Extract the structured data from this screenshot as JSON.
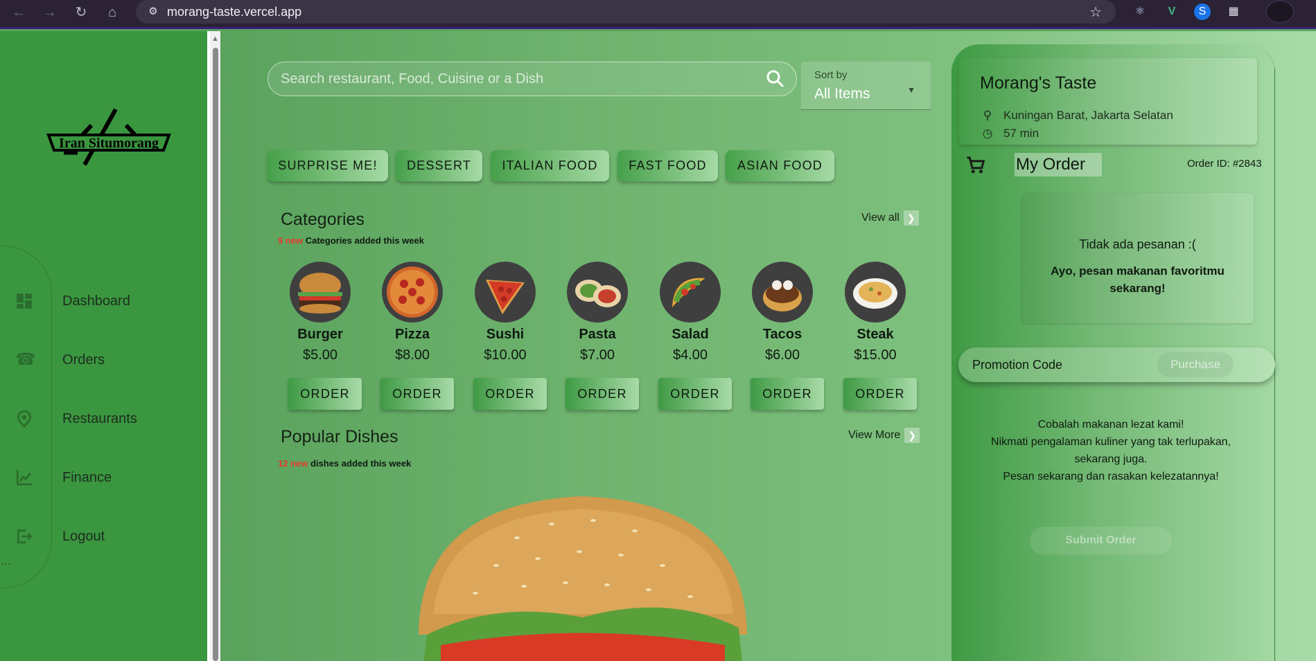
{
  "browser": {
    "url": "morang-taste.vercel.app"
  },
  "sidebar": {
    "logo_text": "Iran Situmorang",
    "items": [
      {
        "label": "Dashboard",
        "icon": "dashboard-icon"
      },
      {
        "label": "Orders",
        "icon": "phone-icon"
      },
      {
        "label": "Restaurants",
        "icon": "location-pin-icon"
      },
      {
        "label": "Finance",
        "icon": "chart-icon"
      },
      {
        "label": "Logout",
        "icon": "logout-icon"
      }
    ],
    "dots": "..."
  },
  "search": {
    "placeholder": "Search restaurant, Food, Cuisine or a Dish"
  },
  "sort": {
    "label": "Sort by",
    "value": "All Items"
  },
  "chips": [
    "SURPRISE ME!",
    "DESSERT",
    "ITALIAN FOOD",
    "FAST FOOD",
    "ASIAN FOOD"
  ],
  "categories": {
    "title": "Categories",
    "new_count": "9 new",
    "subtitle": " Categories added this week",
    "view_all": "View all",
    "items": [
      {
        "name": "Burger",
        "price": "$5.00",
        "button": "ORDER"
      },
      {
        "name": "Pizza",
        "price": "$8.00",
        "button": "ORDER"
      },
      {
        "name": "Sushi",
        "price": "$10.00",
        "button": "ORDER"
      },
      {
        "name": "Pasta",
        "price": "$7.00",
        "button": "ORDER"
      },
      {
        "name": "Salad",
        "price": "$4.00",
        "button": "ORDER"
      },
      {
        "name": "Tacos",
        "price": "$6.00",
        "button": "ORDER"
      },
      {
        "name": "Steak",
        "price": "$15.00",
        "button": "ORDER"
      }
    ]
  },
  "popular": {
    "title": "Popular Dishes",
    "new_count": "12 new",
    "subtitle": " dishes added this week",
    "view_more": "View More"
  },
  "order_panel": {
    "restaurant_name": "Morang's Taste",
    "location": "Kuningan Barat, Jakarta Selatan",
    "time": "57 min",
    "my_order": "My Order",
    "order_id": "Order ID: #2843",
    "empty_title": "Tidak ada pesanan :(",
    "empty_message": "Ayo, pesan makanan favoritmu sekarang!",
    "promo_label": "Promotion Code",
    "purchase": "Purchase",
    "promo_lines": [
      "Cobalah makanan lezat kami!",
      "Nikmati pengalaman kuliner yang tak terlupakan, sekarang juga.",
      "Pesan sekarang dan rasakan kelezatannya!"
    ],
    "submit": "Submit Order"
  },
  "colors": {
    "sidebar": "#3a963f",
    "accent_red": "#e63a2e",
    "main_bg": "#5aa35d"
  }
}
